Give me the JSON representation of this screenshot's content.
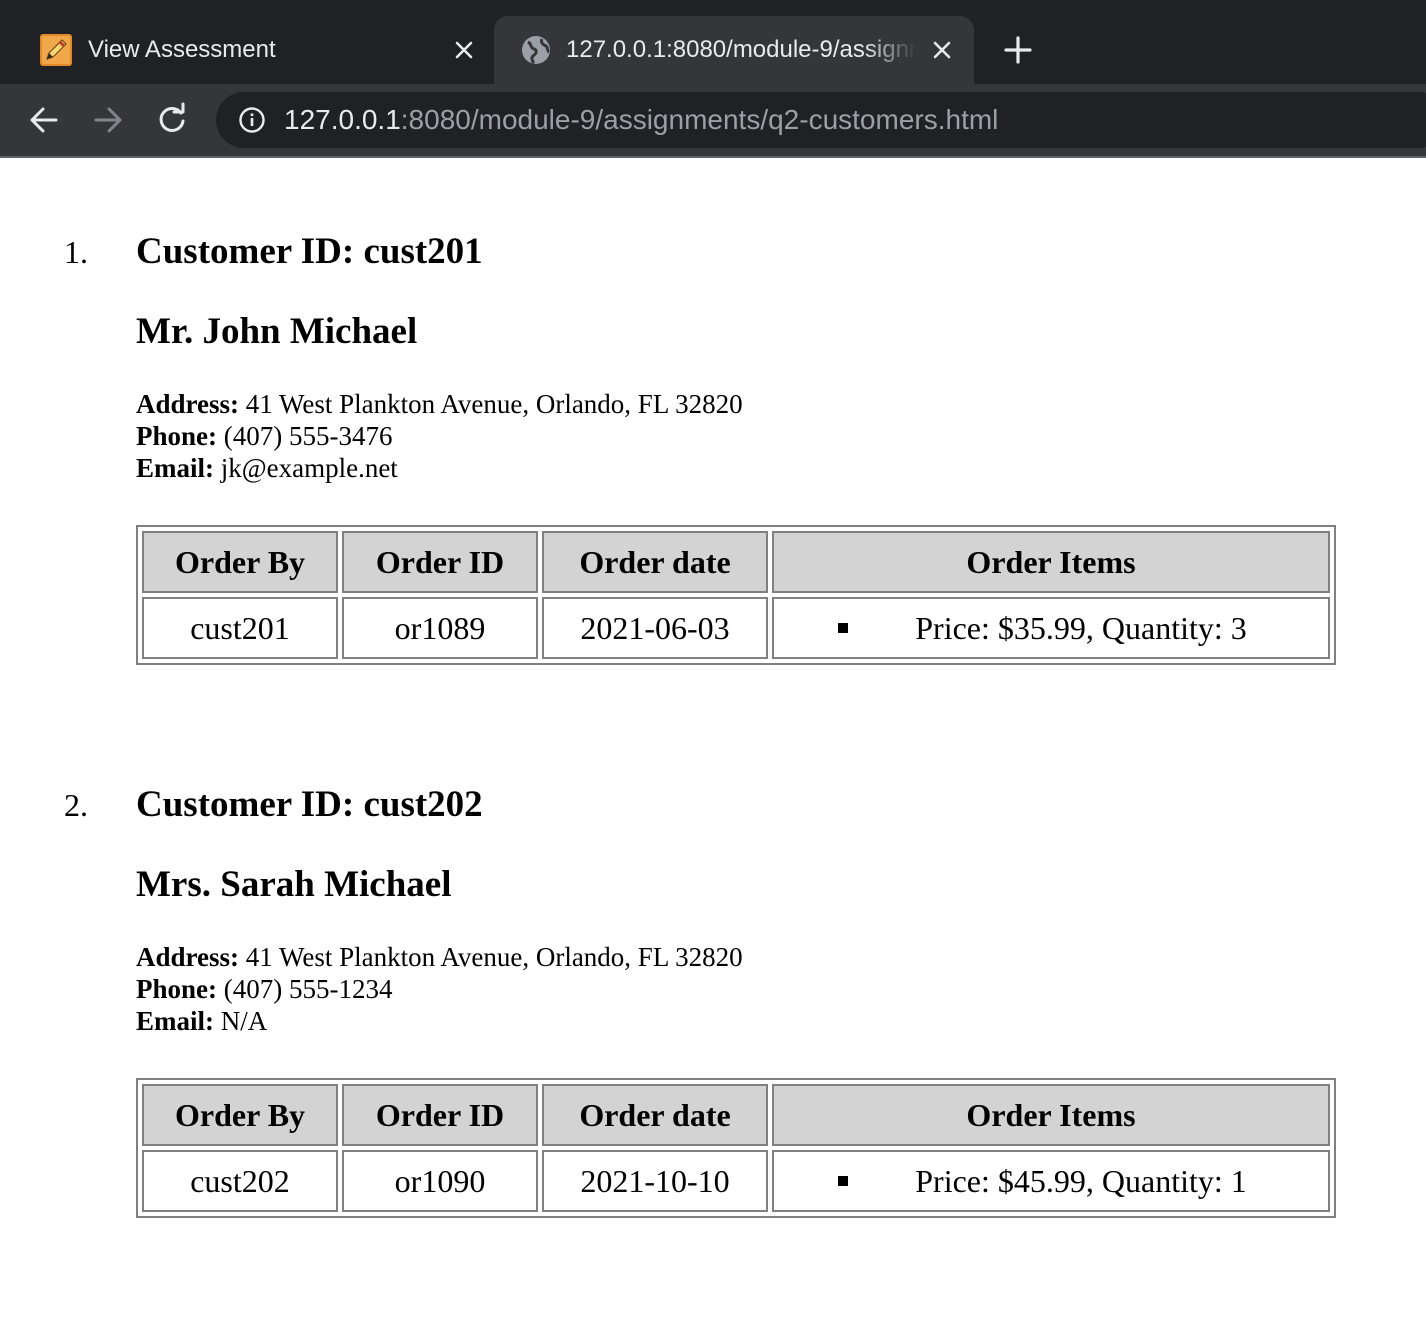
{
  "browser": {
    "tabs": [
      {
        "title": "View Assessment",
        "active": false
      },
      {
        "title": "127.0.0.1:8080/module-9/assignments/q2-customers.html",
        "active": true
      }
    ],
    "url_host": "127.0.0.1",
    "url_rest": ":8080/module-9/assignments/q2-customers.html"
  },
  "labels": {
    "address": "Address:",
    "phone": "Phone:",
    "email": "Email:"
  },
  "table_headers": [
    "Order By",
    "Order ID",
    "Order date",
    "Order Items"
  ],
  "customers": [
    {
      "number": "1.",
      "customer_id_heading": "Customer ID: cust201",
      "name": "Mr. John Michael",
      "address": "41 West Plankton Avenue, Orlando, FL 32820",
      "phone": "(407) 555-3476",
      "email": "jk@example.net",
      "order": {
        "order_by": "cust201",
        "order_id": "or1089",
        "order_date": "2021-06-03",
        "item": "Price: $35.99, Quantity: 3"
      }
    },
    {
      "number": "2.",
      "customer_id_heading": "Customer ID: cust202",
      "name": "Mrs. Sarah Michael",
      "address": "41 West Plankton Avenue, Orlando, FL 32820",
      "phone": "(407) 555-1234",
      "email": "N/A",
      "order": {
        "order_by": "cust202",
        "order_id": "or1090",
        "order_date": "2021-10-10",
        "item": "Price: $45.99, Quantity: 1"
      }
    }
  ]
}
